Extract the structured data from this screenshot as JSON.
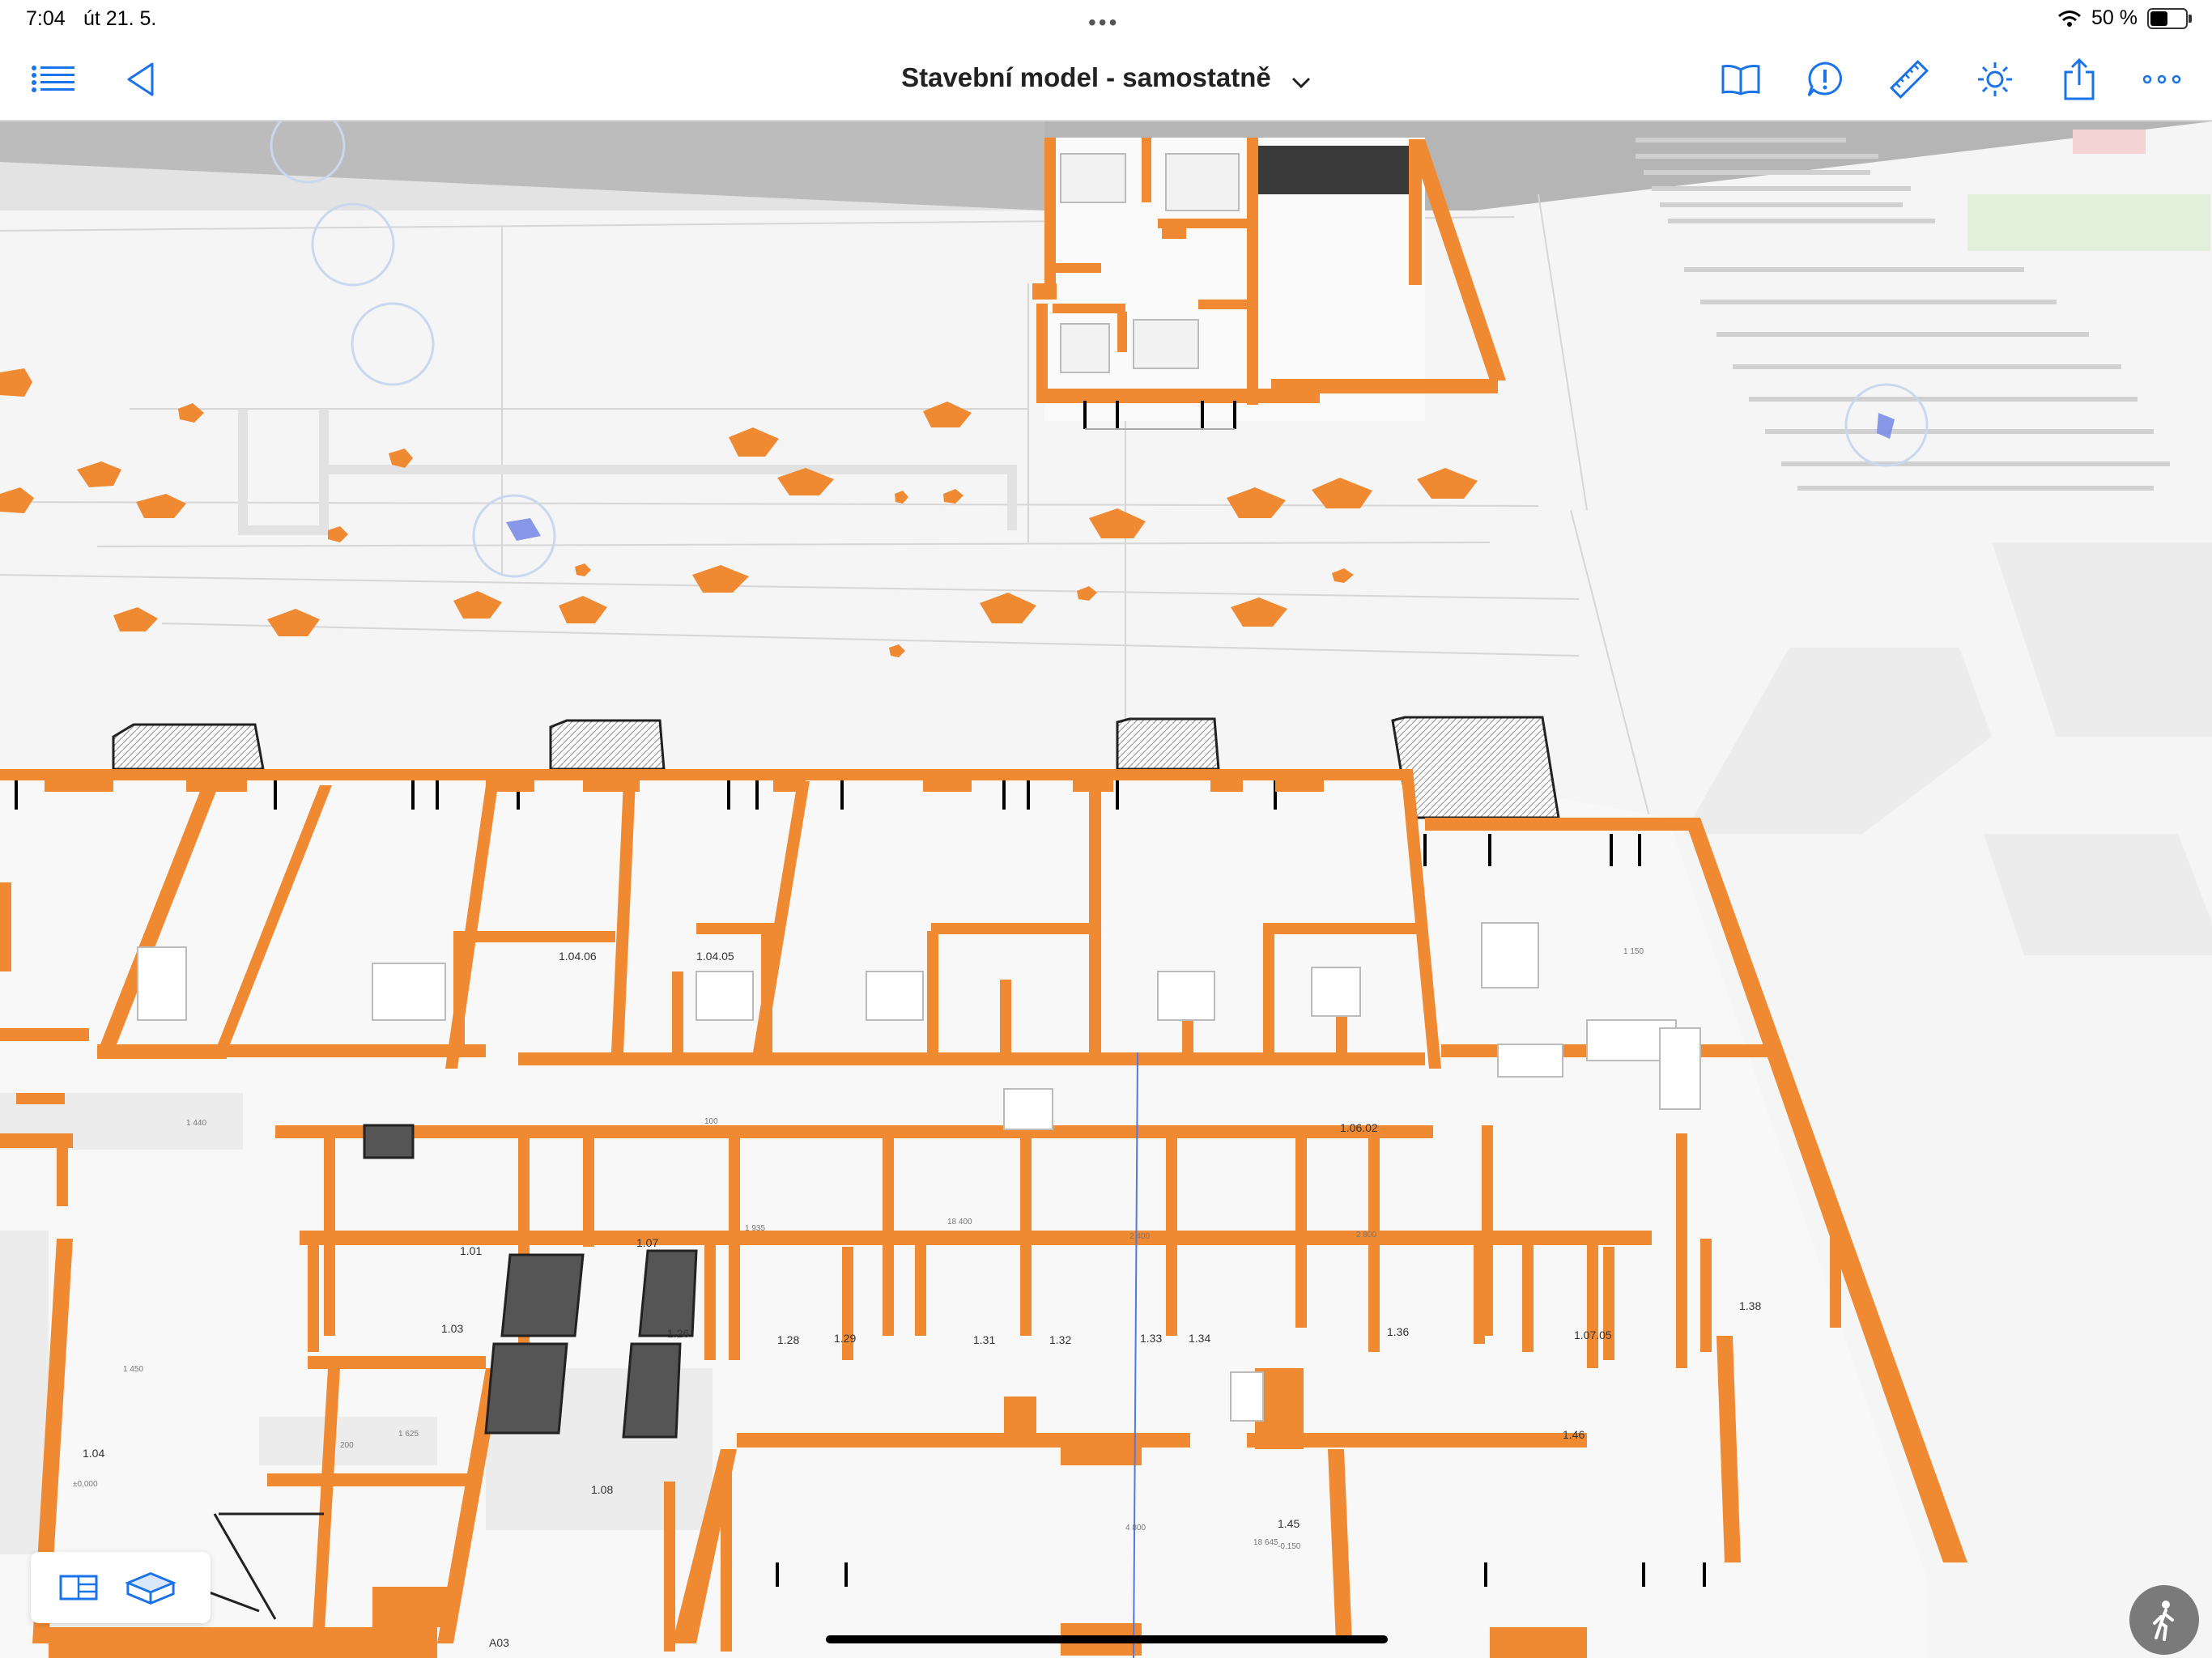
{
  "status_bar": {
    "time": "7:04",
    "date": "út 21. 5.",
    "battery_text": "50 %",
    "battery_level": 0.5
  },
  "toolbar": {
    "title": "Stavební model - samostatně",
    "left_icons": [
      "list-icon",
      "back-triangle-icon"
    ],
    "right_icons": [
      "book-icon",
      "issue-alert-icon",
      "ruler-icon",
      "light-sun-icon",
      "share-icon",
      "more-icon"
    ]
  },
  "plan": {
    "room_labels": [
      "1.04.06",
      "1.04.05",
      "1.06.02",
      "1.03",
      "1.26",
      "1.28",
      "1.29",
      "1.31",
      "1.32",
      "1.33",
      "1.34",
      "1.36",
      "1.07.05",
      "1.38",
      "1.04",
      "1.08",
      "1.45",
      "1.46",
      "1.01",
      "1.07",
      "A03"
    ],
    "dimension_labels": [
      "18 400",
      "18 645",
      "2 400",
      "4 800",
      "2 800",
      "1 150",
      "1 935",
      "1 440",
      "1 450",
      "1 625",
      "200",
      "100"
    ],
    "level_labels": [
      "-0.150",
      "±0,000"
    ]
  },
  "colors": {
    "wall_cut": "#f08a32",
    "accent": "#1a73e8",
    "background": "#f5f5f5"
  },
  "view_modes": [
    "2d-sheet-icon",
    "3d-box-icon"
  ],
  "walk_icon": "walk-person-icon"
}
